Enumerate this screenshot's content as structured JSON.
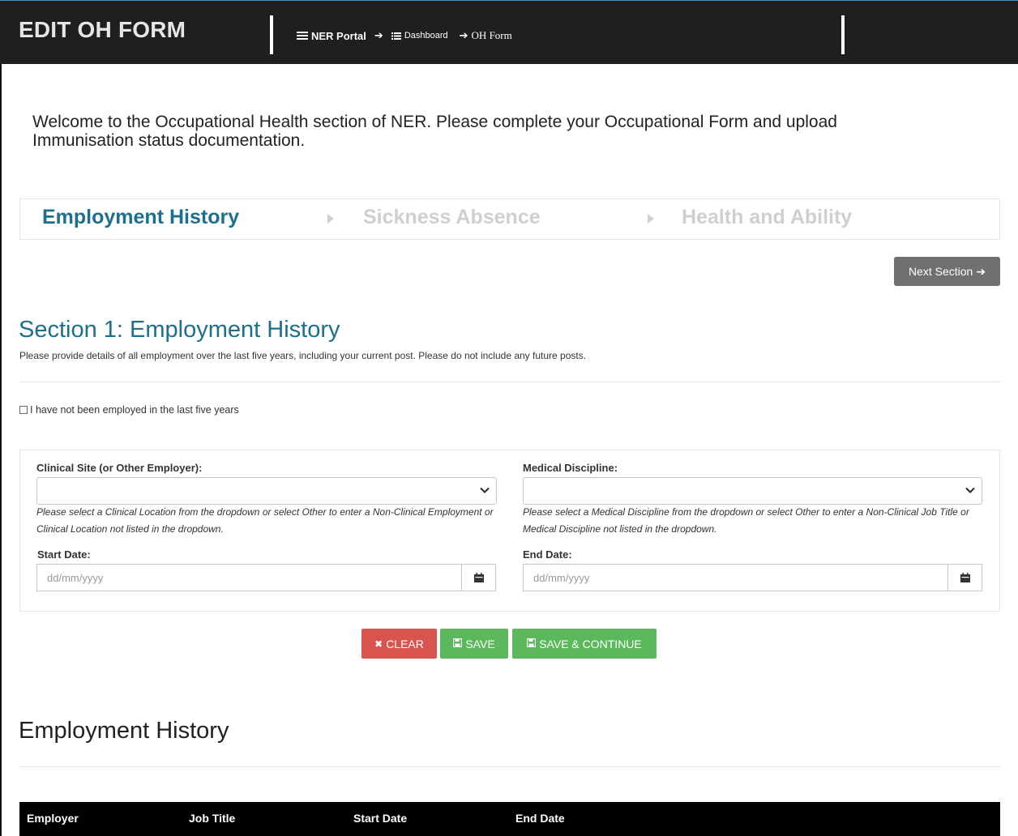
{
  "header": {
    "title": "EDIT OH FORM",
    "breadcrumb": [
      {
        "label": "NER Portal",
        "icon": "list-icon"
      },
      {
        "label": "Dashboard",
        "icon": "list-icon"
      },
      {
        "label": "OH Form",
        "icon": "arrow-right-icon"
      }
    ]
  },
  "welcome_text": "Welcome to the Occupational Health section of NER. Please complete your Occupational Form and upload Immunisation status documentation.",
  "steps": [
    {
      "label": "Employment History",
      "active": true
    },
    {
      "label": "Sickness Absence",
      "active": false
    },
    {
      "label": "Health and Ability",
      "active": false
    }
  ],
  "next_button": "Next Section",
  "section": {
    "title": "Section 1: Employment History",
    "description": "Please provide details of all employment over the last five years, including your current post. Please do not include any future posts."
  },
  "not_employed_checkbox": {
    "label": "I have not been employed in the last five years",
    "checked": false
  },
  "form": {
    "clinical_site": {
      "label": "Clinical Site (or Other Employer):",
      "value": "",
      "help": "Please select a Clinical Location from the dropdown or select Other to enter a Non-Clinical Employment or Clinical Location not listed in the dropdown."
    },
    "medical_discipline": {
      "label": "Medical Discipline:",
      "value": "",
      "help": "Please select a Medical Discipline from the dropdown or select Other to enter a Non-Clinical Job Title or Medical Discipline not listed in the dropdown."
    },
    "start_date": {
      "label": "Start Date:",
      "placeholder": "dd/mm/yyyy"
    },
    "end_date": {
      "label": "End Date:",
      "placeholder": "dd/mm/yyyy"
    }
  },
  "buttons": {
    "clear": "CLEAR",
    "save": "SAVE",
    "save_continue": "SAVE & CONTINUE"
  },
  "history": {
    "title": "Employment History",
    "columns": [
      "Employer",
      "Job Title",
      "Start Date",
      "End Date"
    ]
  },
  "colors": {
    "header_bg": "#1f1f1f",
    "accent": "#1e6e8e",
    "danger": "#d9534f",
    "success": "#5cb85c",
    "muted_button": "#707070"
  }
}
